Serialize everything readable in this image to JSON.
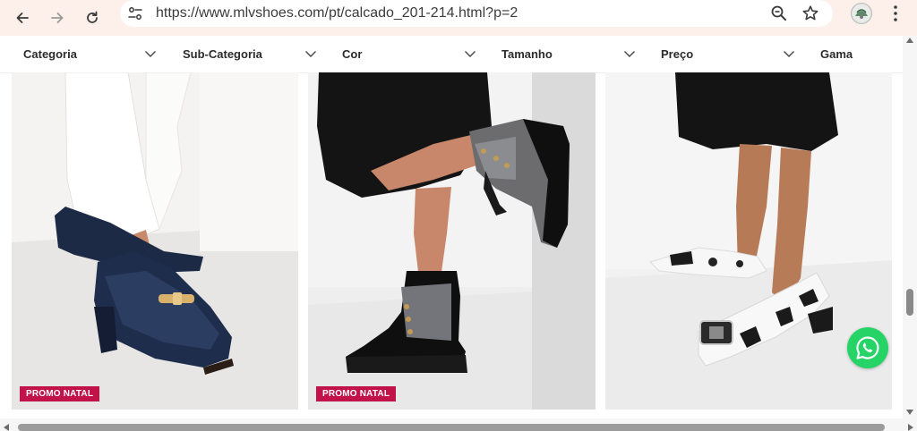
{
  "browser": {
    "url": "https://www.mlvshoes.com/pt/calcado_201-214.html?p=2",
    "icons": {
      "back": "arrow-left-icon",
      "forward": "arrow-right-icon",
      "reload": "reload-icon",
      "site_info": "tune-icon",
      "zoom": "zoom-icon",
      "bookmark": "star-icon",
      "profile": "avatar",
      "menu": "kebab-menu-icon"
    }
  },
  "filters": [
    {
      "label": "Categoria"
    },
    {
      "label": "Sub-Categoria"
    },
    {
      "label": "Cor"
    },
    {
      "label": "Tamanho"
    },
    {
      "label": "Preço"
    },
    {
      "label": "Gama"
    }
  ],
  "products": [
    {
      "badge": "PROMO NATAL",
      "image": "navy patent loafer with gold chain"
    },
    {
      "badge": "PROMO NATAL",
      "image": "black and silver lace-up ankle boots"
    },
    {
      "badge": "",
      "image": "cow print pointed flats with crystal buckle"
    }
  ],
  "colors": {
    "toolbar_bg": "#fdf0ea",
    "badge_bg": "#c2124a",
    "whatsapp": "#25d366"
  }
}
